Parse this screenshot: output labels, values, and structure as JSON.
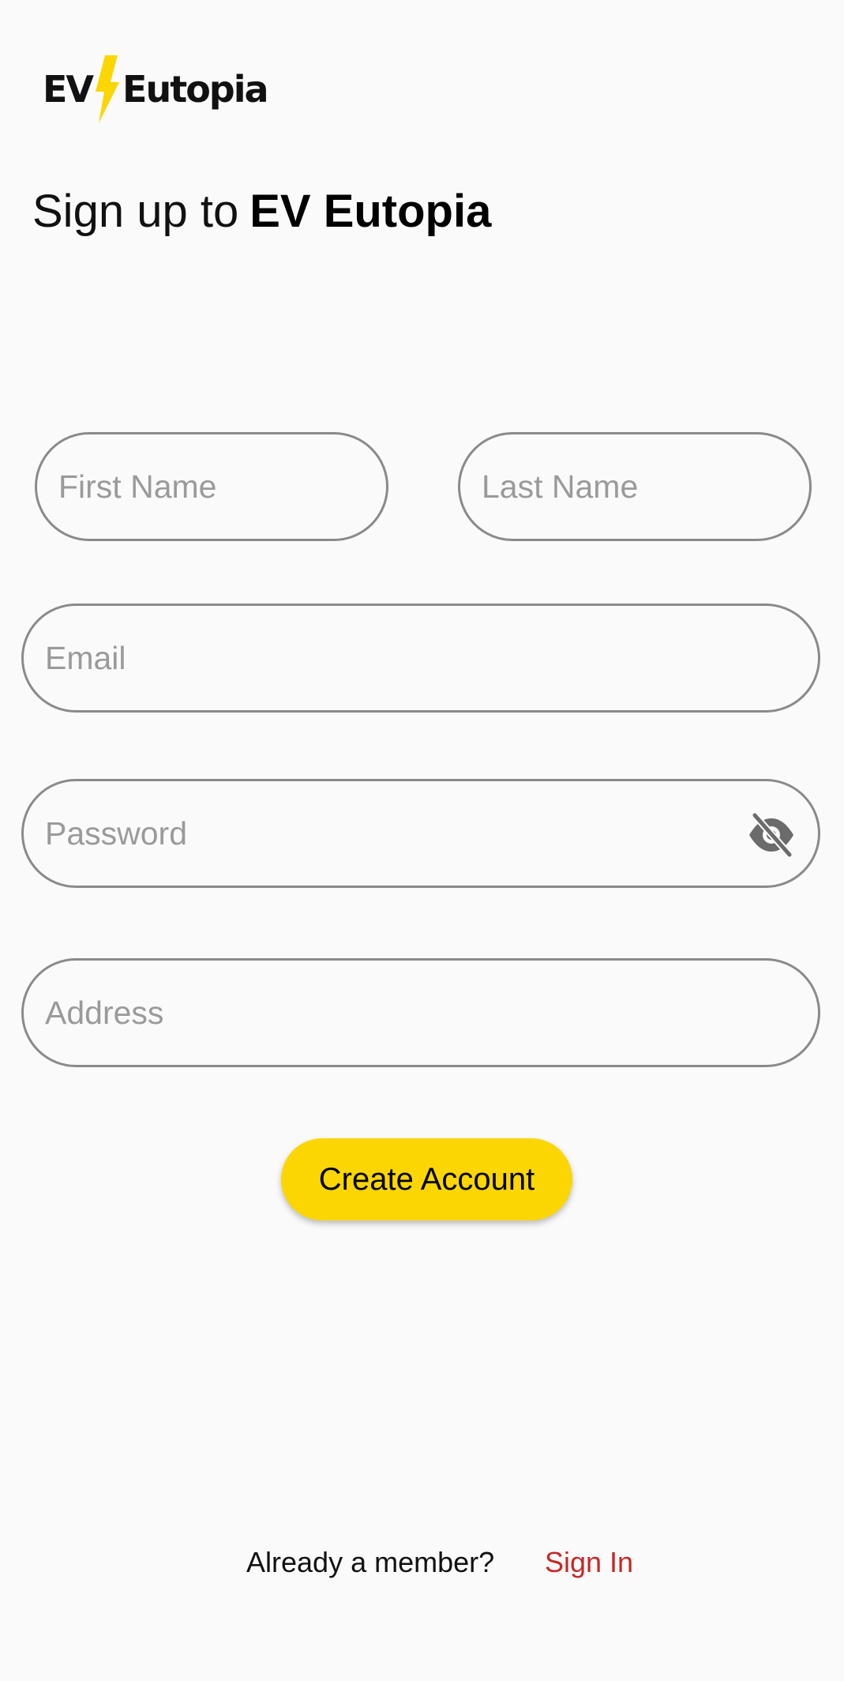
{
  "logo": {
    "ev": "EV",
    "word": "Eutopia",
    "bolt_color": "#fbd602"
  },
  "heading": {
    "prefix": "Sign up to",
    "brand": "EV Eutopia"
  },
  "form": {
    "first_name_placeholder": "First Name",
    "last_name_placeholder": "Last Name",
    "email_placeholder": "Email",
    "password_placeholder": "Password",
    "address_placeholder": "Address",
    "password_toggle_icon": "eye-off-icon"
  },
  "actions": {
    "create_account_label": "Create Account",
    "button_color": "#fbd602"
  },
  "footer": {
    "prompt": "Already a member?",
    "signin_label": "Sign In",
    "signin_color": "#c62828"
  }
}
